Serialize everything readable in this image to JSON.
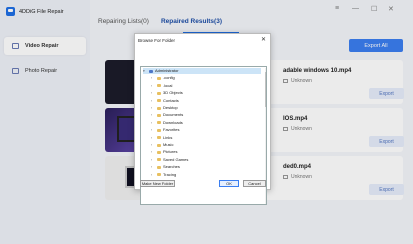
{
  "app": {
    "title": "4DDiG File Repair"
  },
  "window_controls": [
    "≡",
    "—",
    "☐",
    "✕"
  ],
  "sidebar": {
    "items": [
      {
        "label": "Video Repair"
      },
      {
        "label": "Photo Repair"
      }
    ]
  },
  "tabs": [
    {
      "label": "Repairing Lists(0)"
    },
    {
      "label": "Repaired Results(3)"
    }
  ],
  "export_all_label": "Export All",
  "results": [
    {
      "filename": "adable windows 10.mp4",
      "status": "Unknown",
      "export_label": "Export"
    },
    {
      "filename": "IOS.mp4",
      "status": "Unknown",
      "export_label": "Export"
    },
    {
      "filename": "ded0.mp4",
      "status": "Unknown",
      "export_label": "Export"
    }
  ],
  "dialog": {
    "title": "Browse For Folder",
    "close": "✕",
    "tree": [
      {
        "label": "Administrator",
        "selected": true,
        "expanded": true
      },
      {
        "label": ".config"
      },
      {
        "label": ".local"
      },
      {
        "label": "3D Objects"
      },
      {
        "label": "Contacts"
      },
      {
        "label": "Desktop"
      },
      {
        "label": "Documents"
      },
      {
        "label": "Downloads"
      },
      {
        "label": "Favorites"
      },
      {
        "label": "Links"
      },
      {
        "label": "Music"
      },
      {
        "label": "Pictures"
      },
      {
        "label": "Saved Games"
      },
      {
        "label": "Searches"
      },
      {
        "label": "Tracing"
      }
    ],
    "make_folder_label": "Make New Folder",
    "ok_label": "OK",
    "cancel_label": "Cancel"
  }
}
